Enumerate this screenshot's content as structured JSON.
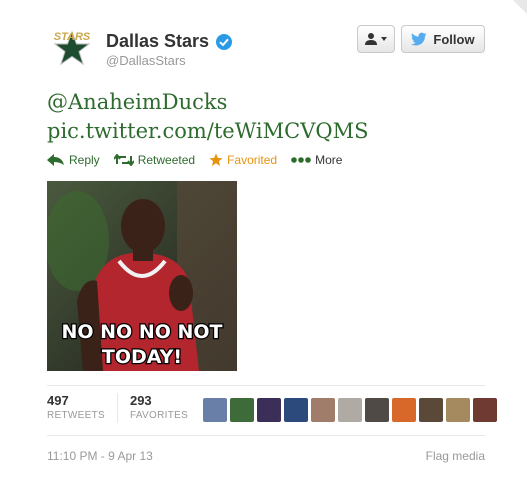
{
  "account": {
    "name": "Dallas Stars",
    "handle": "@DallasStars",
    "logo_text": "STARS"
  },
  "buttons": {
    "follow_label": "Follow"
  },
  "tweet": {
    "mention": "@AnaheimDucks",
    "link": "pic.twitter.com/teWiMCVQMS"
  },
  "actions": [
    {
      "label": "Reply",
      "icon": "reply-arrow-icon"
    },
    {
      "label": "Retweeted",
      "icon": "retweet-icon"
    },
    {
      "label": "Favorited",
      "icon": "star-icon"
    },
    {
      "label": "More",
      "icon": "ellipsis-icon"
    }
  ],
  "media": {
    "caption_line1": "NO NO NO NOT",
    "caption_line2": "TODAY!"
  },
  "stats": {
    "retweets": "497",
    "retweets_label": "RETWEETS",
    "favorites": "293",
    "favorites_label": "FAVORITES"
  },
  "timestamp": "11:10 PM - 9 Apr 13",
  "flag_label": "Flag media",
  "colors": {
    "link_green": "#2e6b2e",
    "favorited_orange": "#e8930c",
    "verified_blue": "#2b9ae6",
    "twitter_blue": "#55acee",
    "meta_gray": "#999999"
  }
}
